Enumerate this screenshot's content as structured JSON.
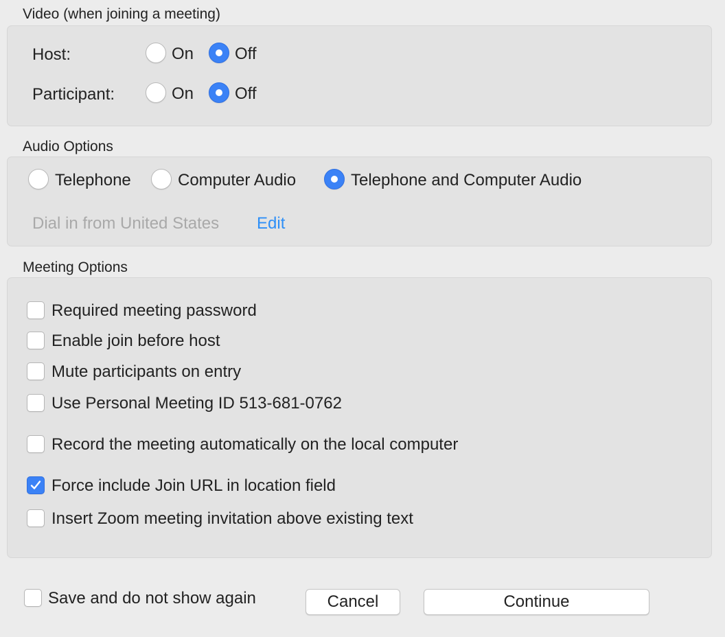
{
  "video": {
    "title": "Video (when joining a meeting)",
    "host": {
      "label": "Host:",
      "on": "On",
      "off": "Off",
      "selected": "Off"
    },
    "participant": {
      "label": "Participant:",
      "on": "On",
      "off": "Off",
      "selected": "Off"
    }
  },
  "audio": {
    "title": "Audio Options",
    "options": [
      "Telephone",
      "Computer Audio",
      "Telephone and Computer Audio"
    ],
    "selected": "Telephone and Computer Audio",
    "dial_in": "Dial in from United States",
    "edit": "Edit"
  },
  "meeting": {
    "title": "Meeting Options",
    "options": [
      {
        "label": "Required meeting password",
        "checked": false
      },
      {
        "label": "Enable join before host",
        "checked": false
      },
      {
        "label": "Mute participants on entry",
        "checked": false
      },
      {
        "label": "Use Personal Meeting ID 513-681-0762",
        "checked": false
      },
      {
        "label": "Record the meeting automatically on the local computer",
        "checked": false
      },
      {
        "label": "Force include Join URL in location field",
        "checked": true
      },
      {
        "label": "Insert Zoom meeting invitation above existing text",
        "checked": false
      }
    ]
  },
  "footer": {
    "save_label": "Save and do not show again",
    "save_checked": false,
    "cancel": "Cancel",
    "continue": "Continue"
  },
  "colors": {
    "accent": "#3b82f6",
    "link": "#2e8ff7"
  }
}
